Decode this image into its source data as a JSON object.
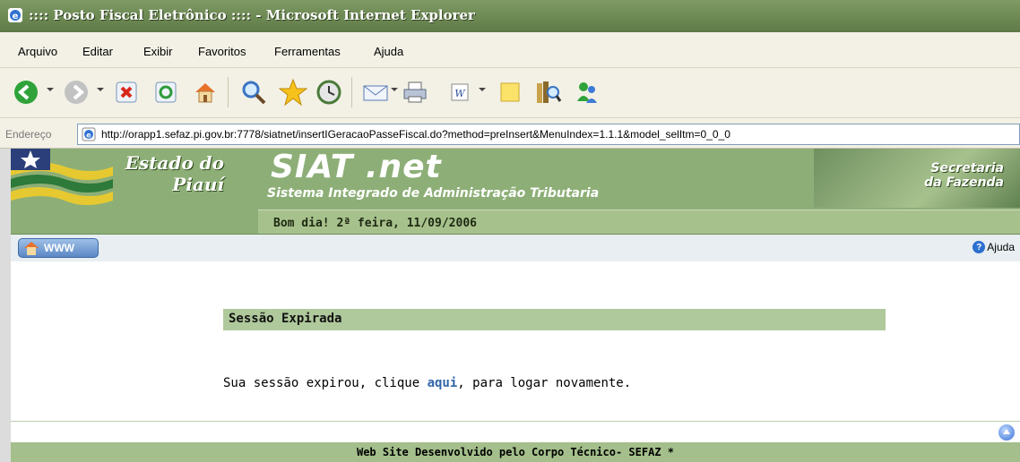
{
  "window": {
    "title": ":::: Posto Fiscal Eletrônico :::: - Microsoft Internet Explorer"
  },
  "menu": [
    "Arquivo",
    "Editar",
    "Exibir",
    "Favoritos",
    "Ferramentas",
    "Ajuda"
  ],
  "address": {
    "label": "Endereço",
    "url": "http://orapp1.sefaz.pi.gov.br:7778/siatnet/insertIGeracaoPasseFiscal.do?method=preInsert&MenuIndex=1.1.1&model_selItm=0_0_0"
  },
  "banner": {
    "estado_line1": "Estado do",
    "estado_line2": "Piauí",
    "siat": "SIAT .net",
    "subtitle": "Sistema Integrado de Administração Tributaria",
    "greeting": "Bom dia! 2ª feira, 11/09/2006",
    "secretaria_line1": "Secretaria",
    "secretaria_line2": "da Fazenda"
  },
  "nav": {
    "www_label": "WWW",
    "help_label": "Ajuda"
  },
  "session": {
    "header": "Sessão Expirada",
    "msg_before": "Sua sessão expirou, clique ",
    "link": "aqui",
    "msg_after": ", para logar novamente."
  },
  "footer": "Web Site Desenvolvido pelo Corpo Técnico- SEFAZ *",
  "colors": {
    "title_bar": "#6b8752",
    "banner_green": "#8daf77",
    "header_green": "#afc99c",
    "link_blue": "#3366aa"
  }
}
